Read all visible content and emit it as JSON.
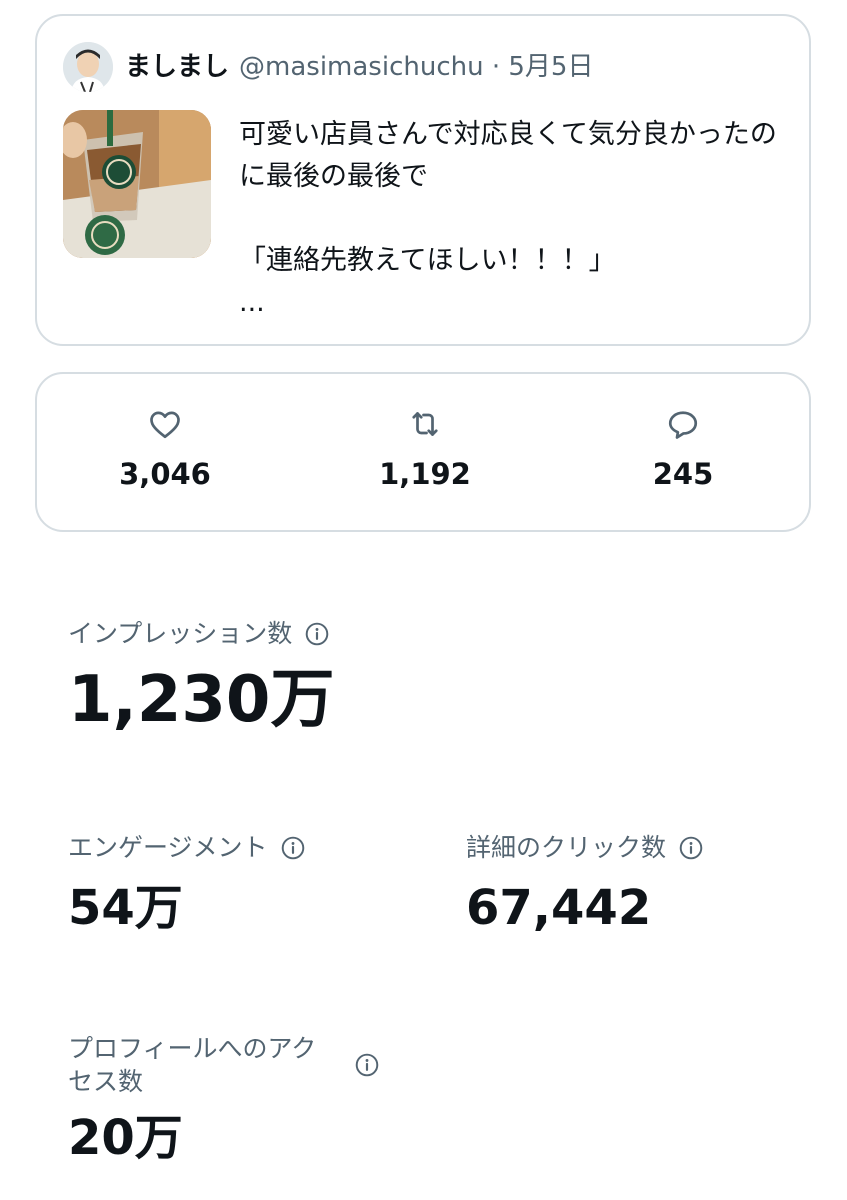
{
  "tweet": {
    "author_name": "ましまし",
    "author_handle": "@masimasichuchu · 5月5日",
    "text_lines": [
      "可愛い店員さんで対応良くて気分良かったのに最後の最後で",
      "「連絡先教えてほしい！！！」",
      "..."
    ]
  },
  "engagement_bar": {
    "likes": {
      "icon": "heart-icon",
      "count": "3,046"
    },
    "retweets": {
      "icon": "retweet-icon",
      "count": "1,192"
    },
    "replies": {
      "icon": "reply-icon",
      "count": "245"
    }
  },
  "metrics": {
    "impressions": {
      "label": "インプレッション数",
      "value": "1,230万"
    },
    "engagements": {
      "label": "エンゲージメント",
      "value": "54万"
    },
    "detail_clicks": {
      "label": "詳細のクリック数",
      "value": "67,442"
    },
    "profile_visits": {
      "label": "プロフィールへのアクセス数",
      "value": "20万"
    }
  },
  "colors": {
    "primary_text": "#0f1419",
    "secondary_text": "#536471",
    "card_border": "#d6dde2"
  }
}
